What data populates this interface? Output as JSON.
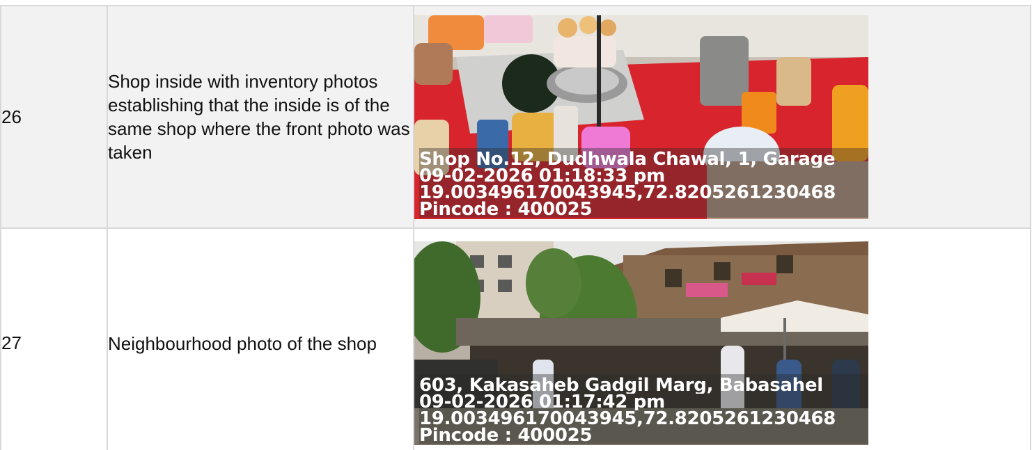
{
  "rows": [
    {
      "number": "26",
      "description": "Shop inside with inventory photos establishing that the inside is of the same shop where the front photo was taken",
      "photo": {
        "address": "Shop No.12, Dudhwala Chawal, 1, Garage",
        "datetime": "09-02-2026 01:18:33 pm",
        "coordinates": "19.003496170043945,72.8205261230468",
        "pincode": "Pincode : 400025"
      }
    },
    {
      "number": "27",
      "description": "Neighbourhood photo of the shop",
      "photo": {
        "address": "603, Kakasaheb Gadgil Marg, Babasahel",
        "datetime": "09-02-2026 01:17:42 pm",
        "coordinates": "19.003496170043945,72.8205261230468",
        "pincode": "Pincode : 400025"
      }
    }
  ]
}
